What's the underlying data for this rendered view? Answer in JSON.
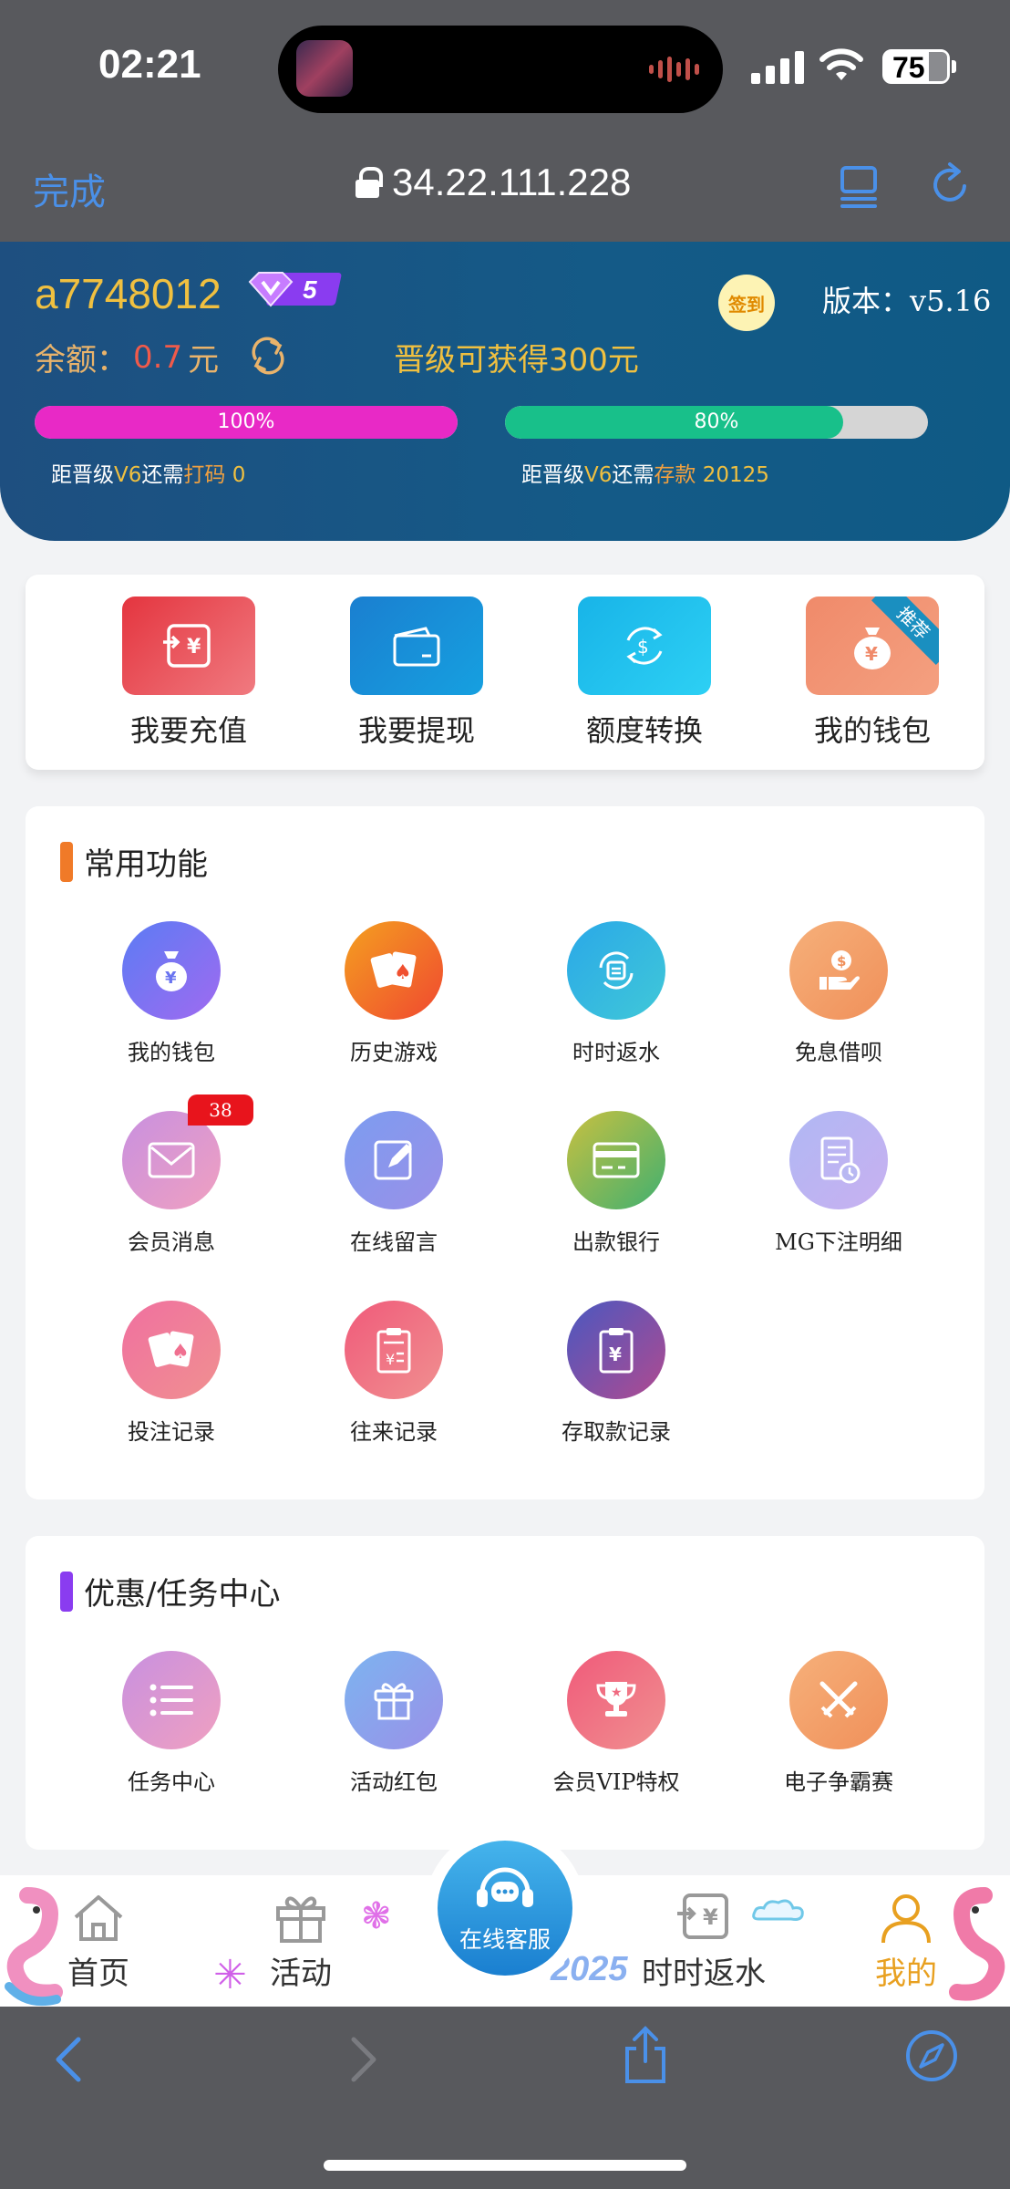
{
  "status_bar": {
    "time": "02:21",
    "battery": "75"
  },
  "browser": {
    "done": "完成",
    "url": "34.22.111.228"
  },
  "account": {
    "username": "a7748012",
    "vip_level": "5",
    "sign_in": "签到",
    "version": "版本：v5.16",
    "balance_label": "余额：",
    "balance_value": "0.7",
    "balance_unit": "元",
    "promo": "晋级可获得300元",
    "progress": [
      {
        "percent": 100,
        "label": "100%",
        "note_prefix": "距晋级",
        "note_level": "V6",
        "note_mid": "还需",
        "note_kind": "打码",
        "note_value": "0"
      },
      {
        "percent": 80,
        "label": "80%",
        "note_prefix": "距晋级",
        "note_level": "V6",
        "note_mid": "还需",
        "note_kind": "存款",
        "note_value": "20125"
      }
    ]
  },
  "quick_actions": [
    {
      "label": "我要充值"
    },
    {
      "label": "我要提现"
    },
    {
      "label": "额度转换"
    },
    {
      "label": "我的钱包",
      "ribbon": "推荐"
    }
  ],
  "common": {
    "title": "常用功能",
    "items": [
      {
        "label": "我的钱包"
      },
      {
        "label": "历史游戏"
      },
      {
        "label": "时时返水"
      },
      {
        "label": "免息借呗"
      },
      {
        "label": "会员消息",
        "badge": "38"
      },
      {
        "label": "在线留言"
      },
      {
        "label": "出款银行"
      },
      {
        "label": "MG下注明细"
      },
      {
        "label": "投注记录"
      },
      {
        "label": "往来记录"
      },
      {
        "label": "存取款记录"
      }
    ]
  },
  "tasks": {
    "title": "优惠/任务中心",
    "items": [
      {
        "label": "任务中心"
      },
      {
        "label": "活动红包"
      },
      {
        "label": "会员VIP特权"
      },
      {
        "label": "电子争霸赛"
      }
    ]
  },
  "tabbar": {
    "home": "首页",
    "activity": "活动",
    "service": "在线客服",
    "rebate": "时时返水",
    "mine": "我的",
    "year": "2025"
  },
  "colors": {
    "accent": "#f0c040",
    "header": "#145a87",
    "active_tab": "#e8a020"
  }
}
